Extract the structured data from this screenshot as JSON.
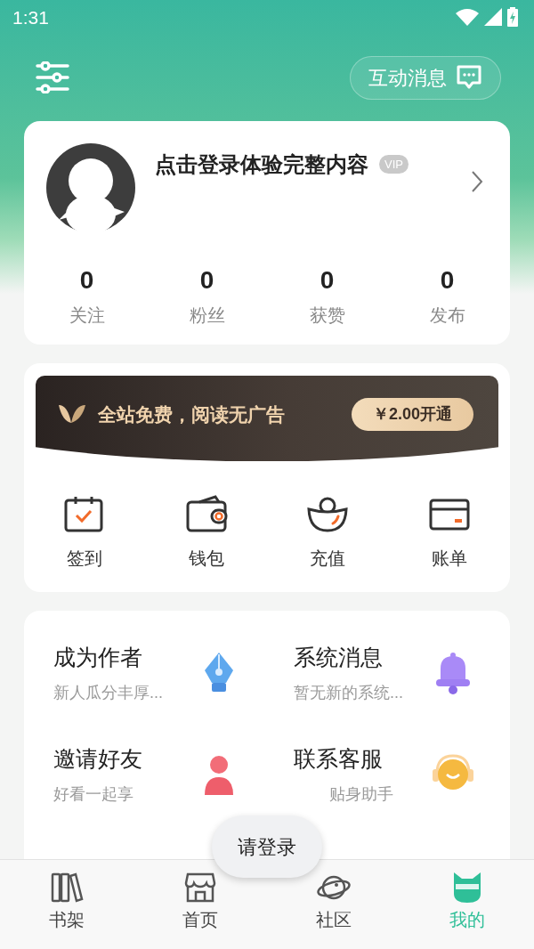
{
  "status_bar": {
    "time": "1:31"
  },
  "header": {
    "messages_button": "互动消息"
  },
  "profile": {
    "title": "点击登录体验完整内容",
    "badge": "VIP",
    "stats": [
      {
        "value": "0",
        "label": "关注"
      },
      {
        "value": "0",
        "label": "粉丝"
      },
      {
        "value": "0",
        "label": "获赞"
      },
      {
        "value": "0",
        "label": "发布"
      }
    ]
  },
  "vip_banner": {
    "text": "全站免费，阅读无广告",
    "button": "￥2.00开通"
  },
  "wallet_items": [
    {
      "label": "签到"
    },
    {
      "label": "钱包"
    },
    {
      "label": "充值"
    },
    {
      "label": "账单"
    }
  ],
  "features": [
    {
      "title": "成为作者",
      "subtitle": "新人瓜分丰厚..."
    },
    {
      "title": "系统消息",
      "subtitle": "暂无新的系统..."
    },
    {
      "title": "邀请好友",
      "subtitle": "好看一起享"
    },
    {
      "title": "联系客服",
      "subtitle": "贴身助手"
    }
  ],
  "toast": "请登录",
  "tabs": [
    {
      "label": "书架",
      "selected": false
    },
    {
      "label": "首页",
      "selected": false
    },
    {
      "label": "社区",
      "selected": false
    },
    {
      "label": "我的",
      "selected": true
    }
  ]
}
